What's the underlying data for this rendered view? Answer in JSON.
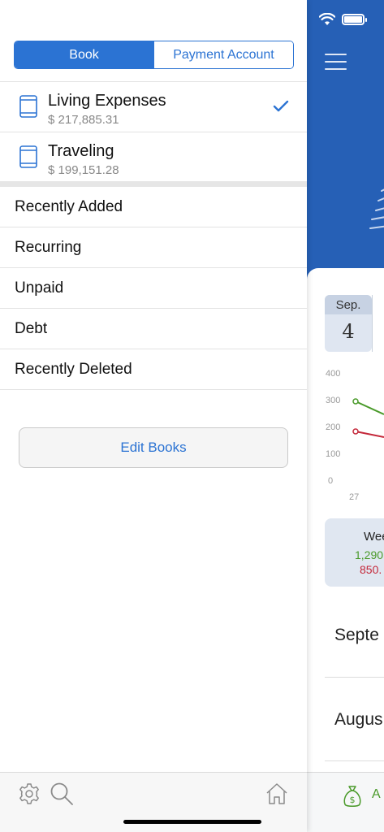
{
  "segment": {
    "book_label": "Book",
    "payment_account_label": "Payment Account",
    "selected": "Book"
  },
  "books": [
    {
      "name": "Living Expenses",
      "amount": "$ 217,885.31",
      "selected": true
    },
    {
      "name": "Traveling",
      "amount": "$ 199,151.28",
      "selected": false
    }
  ],
  "menu": [
    {
      "label": "Recently Added"
    },
    {
      "label": "Recurring"
    },
    {
      "label": "Unpaid"
    },
    {
      "label": "Debt"
    },
    {
      "label": "Recently Deleted"
    }
  ],
  "edit_books_label": "Edit Books",
  "toolbar": {
    "icons": [
      "gear-icon",
      "search-icon",
      "home-icon"
    ]
  },
  "background": {
    "date": {
      "month": "Sep.",
      "day": "4"
    },
    "chart_ticks": [
      "400",
      "300",
      "200",
      "100",
      "0"
    ],
    "x_tick": "27",
    "summary": {
      "label": "Wee",
      "income": "1,290",
      "expense": "850."
    },
    "months": [
      "Septe",
      "Augus"
    ],
    "tab_label": "A"
  },
  "colors": {
    "accent": "#2b73d3",
    "header": "#2660b6",
    "income": "#4a9a2a",
    "expense": "#c4283a"
  }
}
